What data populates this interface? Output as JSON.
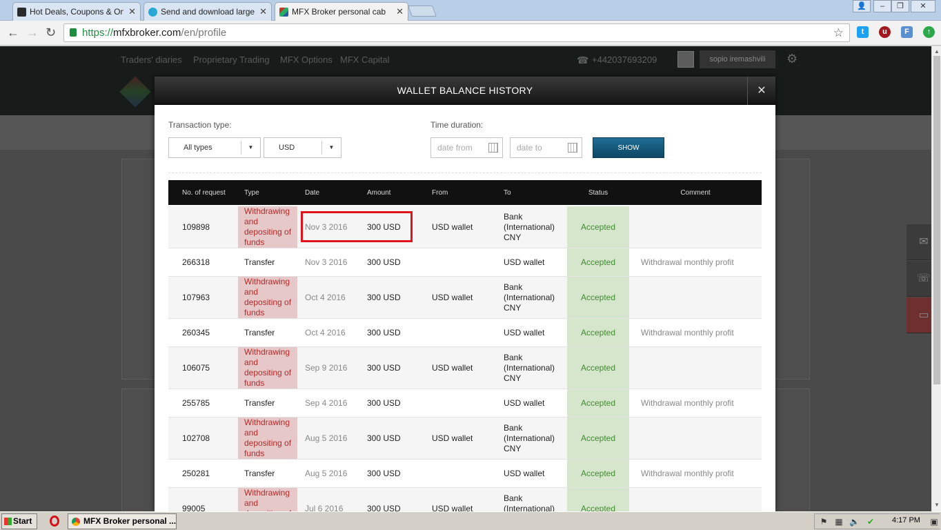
{
  "browser": {
    "tabs": [
      {
        "label": "Hot Deals, Coupons & Online",
        "favicon_color": "#2b2b2b"
      },
      {
        "label": "Send and download large fil",
        "favicon_color": "#29a8d6"
      },
      {
        "label": "MFX Broker personal cabinet",
        "favicon_color": "#c0392b"
      }
    ],
    "url": {
      "scheme": "https://",
      "host": "mfxbroker.com",
      "path": "/en/profile"
    }
  },
  "site": {
    "nav": [
      "Traders' diaries",
      "Proprietary Trading",
      "MFX Options",
      "MFX Capital"
    ],
    "phone": "+442037693209",
    "user": "sopio iremashvili"
  },
  "modal": {
    "title": "WALLET BALANCE HISTORY",
    "filters": {
      "transaction_type_label": "Transaction type:",
      "type_value": "All types",
      "currency_value": "USD",
      "time_duration_label": "Time duration:",
      "date_from_placeholder": "date from",
      "date_to_placeholder": "date to",
      "show_label": "SHOW"
    },
    "columns": [
      "No. of request",
      "Type",
      "Date",
      "Amount",
      "From",
      "To",
      "Status",
      "Comment"
    ],
    "rows": [
      {
        "id": "109898",
        "type": "Withdrawing and depositing of funds",
        "kind": "w",
        "date": "Nov 3 2016",
        "amount": "300 USD",
        "from": "USD wallet",
        "to": "Bank (International) CNY",
        "status": "Accepted",
        "comment": ""
      },
      {
        "id": "266318",
        "type": "Transfer",
        "kind": "t",
        "date": "Nov 3 2016",
        "amount": "300 USD",
        "from": "",
        "to": "USD wallet",
        "status": "Accepted",
        "comment": "Withdrawal monthly profit"
      },
      {
        "id": "107963",
        "type": "Withdrawing and depositing of funds",
        "kind": "w",
        "date": "Oct 4 2016",
        "amount": "300 USD",
        "from": "USD wallet",
        "to": "Bank (International) CNY",
        "status": "Accepted",
        "comment": ""
      },
      {
        "id": "260345",
        "type": "Transfer",
        "kind": "t",
        "date": "Oct 4 2016",
        "amount": "300 USD",
        "from": "",
        "to": "USD wallet",
        "status": "Accepted",
        "comment": "Withdrawal monthly profit"
      },
      {
        "id": "106075",
        "type": "Withdrawing and depositing of funds",
        "kind": "w",
        "date": "Sep 9 2016",
        "amount": "300 USD",
        "from": "USD wallet",
        "to": "Bank (International) CNY",
        "status": "Accepted",
        "comment": ""
      },
      {
        "id": "255785",
        "type": "Transfer",
        "kind": "t",
        "date": "Sep 4 2016",
        "amount": "300 USD",
        "from": "",
        "to": "USD wallet",
        "status": "Accepted",
        "comment": "Withdrawal monthly profit"
      },
      {
        "id": "102708",
        "type": "Withdrawing and depositing of funds",
        "kind": "w",
        "date": "Aug 5 2016",
        "amount": "300 USD",
        "from": "USD wallet",
        "to": "Bank (International) CNY",
        "status": "Accepted",
        "comment": ""
      },
      {
        "id": "250281",
        "type": "Transfer",
        "kind": "t",
        "date": "Aug 5 2016",
        "amount": "300 USD",
        "from": "",
        "to": "USD wallet",
        "status": "Accepted",
        "comment": "Withdrawal monthly profit"
      },
      {
        "id": "99005",
        "type": "Withdrawing and depositing of funds",
        "kind": "w",
        "date": "Jul 6 2016",
        "amount": "300 USD",
        "from": "USD wallet",
        "to": "Bank (International) CNY",
        "status": "Accepted",
        "comment": ""
      }
    ]
  },
  "taskbar": {
    "start_label": "Start",
    "task_label": "MFX Broker personal ...",
    "clock": "4:17 PM"
  },
  "colors": {
    "accent": "#0e4764",
    "highlight": "#e0121b",
    "status_bg": "#d6e6cc",
    "withdraw_bg": "#e6c8c8"
  }
}
